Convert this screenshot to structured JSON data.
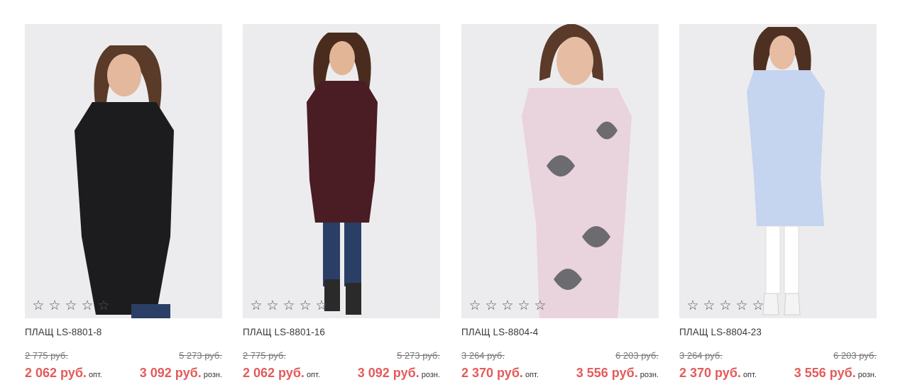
{
  "products": [
    {
      "name": "ПЛАЩ LS-8801-8",
      "old_opt": "2 775 руб.",
      "old_retail": "5 273 руб.",
      "opt_price": "2 062 руб.",
      "opt_label": "опт.",
      "retail_price": "3 092 руб.",
      "retail_label": "розн.",
      "rating": 0,
      "coat_color": "#1c1c1e"
    },
    {
      "name": "ПЛАЩ LS-8801-16",
      "old_opt": "2 775 руб.",
      "old_retail": "5 273 руб.",
      "opt_price": "2 062 руб.",
      "opt_label": "опт.",
      "retail_price": "3 092 руб.",
      "retail_label": "розн.",
      "rating": 0,
      "coat_color": "#4a1c24"
    },
    {
      "name": "ПЛАЩ LS-8804-4",
      "old_opt": "3 264 руб.",
      "old_retail": "6 203 руб.",
      "opt_price": "2 370 руб.",
      "opt_label": "опт.",
      "retail_price": "3 556 руб.",
      "retail_label": "розн.",
      "rating": 0,
      "coat_color": "#e9d3dc"
    },
    {
      "name": "ПЛАЩ LS-8804-23",
      "old_opt": "3 264 руб.",
      "old_retail": "6 203 руб.",
      "opt_price": "2 370 руб.",
      "opt_label": "опт.",
      "retail_price": "3 556 руб.",
      "retail_label": "розн.",
      "rating": 0,
      "coat_color": "#c5d4ef"
    }
  ],
  "colors": {
    "price_accent": "#e35b5b",
    "photo_background": "#ececee"
  },
  "icons": {
    "star": "star-outline-icon"
  }
}
